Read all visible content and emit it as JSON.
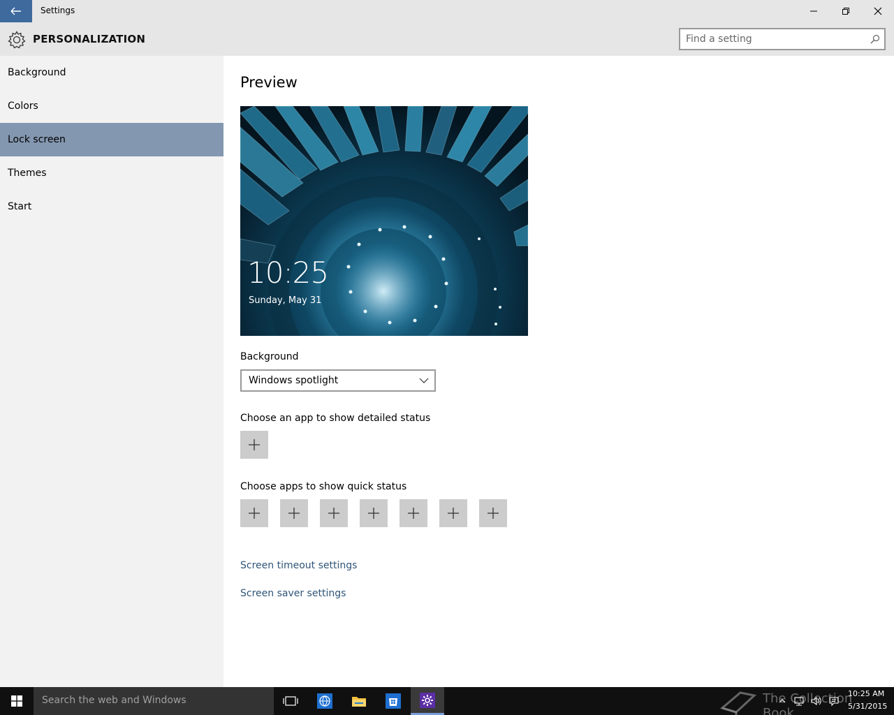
{
  "window": {
    "title": "Settings",
    "back_icon": "arrow-left-icon",
    "controls": [
      "minimize-icon",
      "restore-icon",
      "close-icon"
    ]
  },
  "header": {
    "title": "PERSONALIZATION",
    "icon": "gear-icon",
    "search_placeholder": "Find a setting"
  },
  "sidebar": {
    "items": [
      {
        "label": "Background",
        "selected": false
      },
      {
        "label": "Colors",
        "selected": false
      },
      {
        "label": "Lock screen",
        "selected": true
      },
      {
        "label": "Themes",
        "selected": false
      },
      {
        "label": "Start",
        "selected": false
      }
    ]
  },
  "main": {
    "preview_title": "Preview",
    "preview_time": "10:25",
    "preview_date": "Sunday, May 31",
    "background_label": "Background",
    "background_value": "Windows spotlight",
    "detailed_status_label": "Choose an app to show detailed status",
    "quick_status_label": "Choose apps to show quick status",
    "quick_status_slots": 7,
    "links": {
      "timeout": "Screen timeout settings",
      "saver": "Screen saver settings"
    }
  },
  "taskbar": {
    "search_text": "Search the web and Windows",
    "watermark": "The Collection Book",
    "time": "10:25 AM",
    "date": "5/31/2015"
  },
  "colors": {
    "accent_back_button": "#3e6a9e",
    "selected_nav": "#8497b0",
    "link": "#2f5578",
    "tile": "#cccccc"
  }
}
